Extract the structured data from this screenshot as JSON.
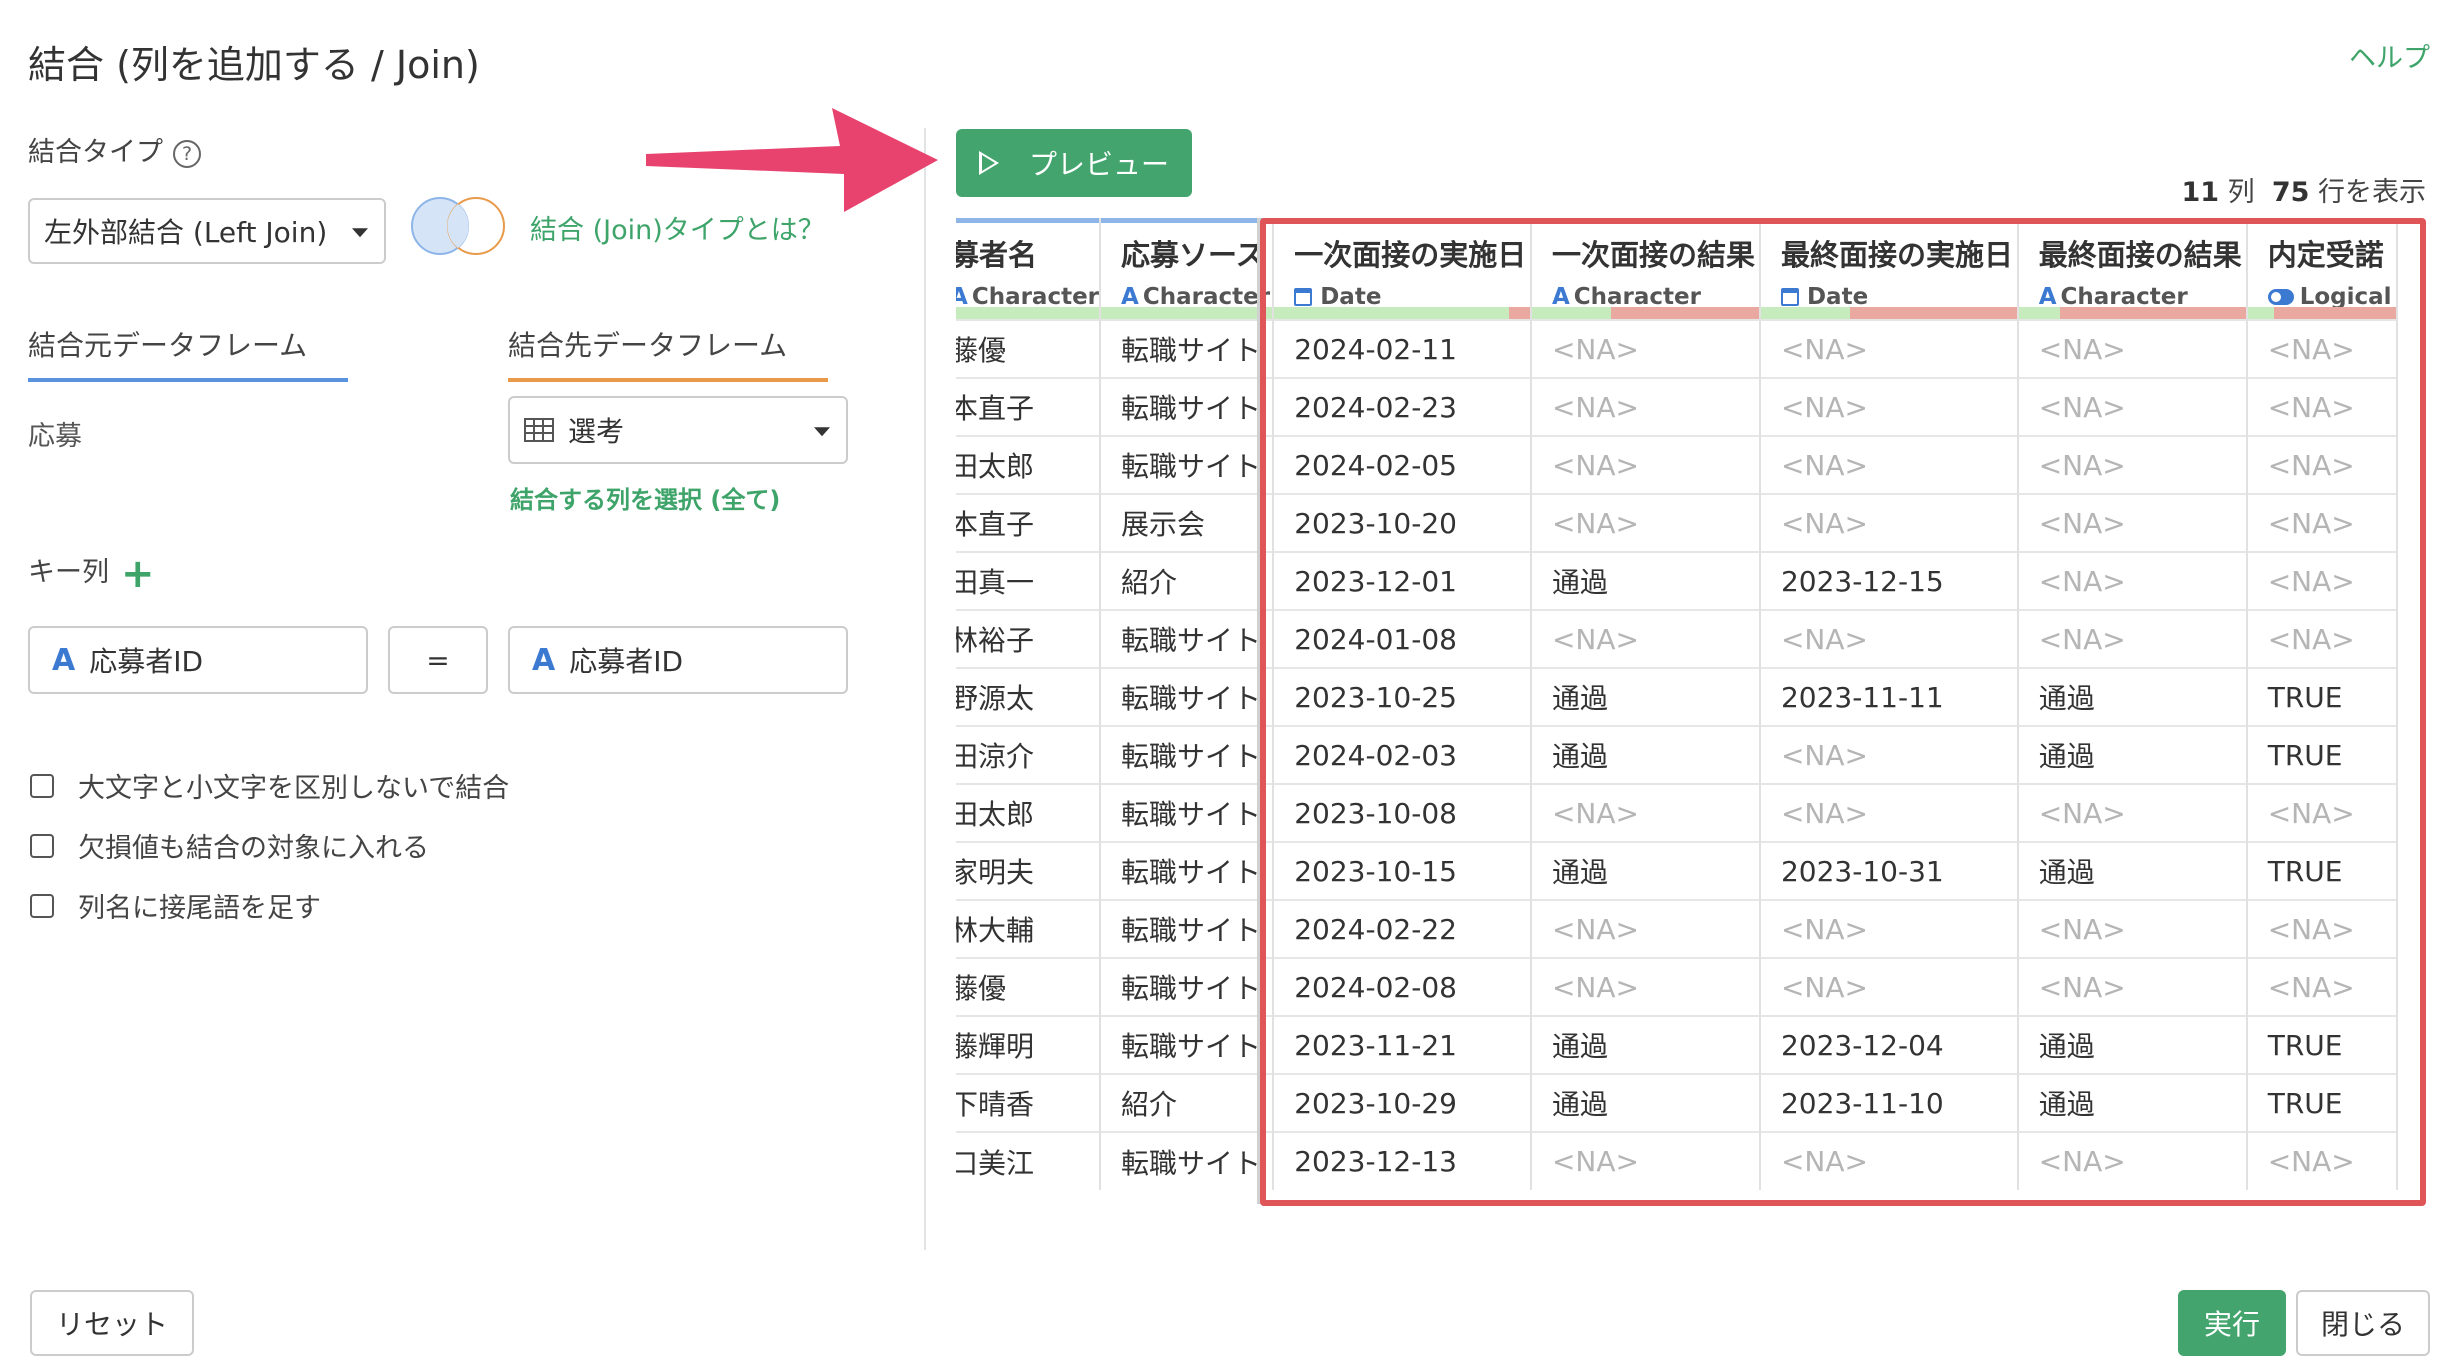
{
  "title": "結合 (列を追加する / Join)",
  "help": "ヘルプ",
  "join_type": {
    "label": "結合タイプ",
    "help_icon": "?",
    "value": "左外部結合 (Left Join)",
    "info_link": "結合 (Join)タイプとは？"
  },
  "tabs": {
    "source": "結合元データフレーム",
    "target": "結合先データフレーム"
  },
  "source_df": "応募",
  "target_df": {
    "value": "選考",
    "icon": "table-icon"
  },
  "select_columns_link": "結合する列を選択 (全て)",
  "key": {
    "label": "キー列",
    "add": "+",
    "left": "応募者ID",
    "op": "=",
    "right": "応募者ID",
    "type_icon": "A"
  },
  "options": [
    {
      "label": "大文字と小文字を区別しないで結合",
      "checked": false
    },
    {
      "label": "欠損値も結合の対象に入れる",
      "checked": false
    },
    {
      "label": "列名に接尾語を足す",
      "checked": false
    }
  ],
  "preview_button": "プレビュー",
  "counts": {
    "cols": "11",
    "cols_unit": "列",
    "rows": "75",
    "rows_unit": "行を表示"
  },
  "columns": [
    {
      "name": "募者名",
      "type": "Character",
      "type_icon": "A",
      "ok": 1.0
    },
    {
      "name": "応募ソース",
      "type": "Character",
      "type_icon": "A",
      "ok": 1.0
    },
    {
      "name": "一次面接の実施日",
      "type": "Date",
      "type_icon": "calendar",
      "ok": 0.92
    },
    {
      "name": "一次面接の結果",
      "type": "Character",
      "type_icon": "A",
      "ok": 0.35
    },
    {
      "name": "最終面接の実施日",
      "type": "Date",
      "type_icon": "calendar",
      "ok": 0.35
    },
    {
      "name": "最終面接の結果",
      "type": "Character",
      "type_icon": "A",
      "ok": 0.18
    },
    {
      "name": "内定受諾",
      "type": "Logical",
      "type_icon": "toggle",
      "ok": 0.18
    }
  ],
  "rows": [
    [
      "藤優",
      "転職サイト",
      "2024-02-11",
      "<NA>",
      "<NA>",
      "<NA>",
      "<NA>"
    ],
    [
      "本直子",
      "転職サイト",
      "2024-02-23",
      "<NA>",
      "<NA>",
      "<NA>",
      "<NA>"
    ],
    [
      "田太郎",
      "転職サイト",
      "2024-02-05",
      "<NA>",
      "<NA>",
      "<NA>",
      "<NA>"
    ],
    [
      "本直子",
      "展示会",
      "2023-10-20",
      "<NA>",
      "<NA>",
      "<NA>",
      "<NA>"
    ],
    [
      "田真一",
      "紹介",
      "2023-12-01",
      "通過",
      "2023-12-15",
      "<NA>",
      "<NA>"
    ],
    [
      "林裕子",
      "転職サイト",
      "2024-01-08",
      "<NA>",
      "<NA>",
      "<NA>",
      "<NA>"
    ],
    [
      "野源太",
      "転職サイト",
      "2023-10-25",
      "通過",
      "2023-11-11",
      "通過",
      "TRUE"
    ],
    [
      "田涼介",
      "転職サイト",
      "2024-02-03",
      "通過",
      "<NA>",
      "通過",
      "TRUE"
    ],
    [
      "田太郎",
      "転職サイト",
      "2023-10-08",
      "<NA>",
      "<NA>",
      "<NA>",
      "<NA>"
    ],
    [
      "家明夫",
      "転職サイト",
      "2023-10-15",
      "通過",
      "2023-10-31",
      "通過",
      "TRUE"
    ],
    [
      "林大輔",
      "転職サイト",
      "2024-02-22",
      "<NA>",
      "<NA>",
      "<NA>",
      "<NA>"
    ],
    [
      "藤優",
      "転職サイト",
      "2024-02-08",
      "<NA>",
      "<NA>",
      "<NA>",
      "<NA>"
    ],
    [
      "藤輝明",
      "転職サイト",
      "2023-11-21",
      "通過",
      "2023-12-04",
      "通過",
      "TRUE"
    ],
    [
      "下晴香",
      "紹介",
      "2023-10-29",
      "通過",
      "2023-11-10",
      "通過",
      "TRUE"
    ],
    [
      "口美江",
      "転職サイト",
      "2023-12-13",
      "<NA>",
      "<NA>",
      "<NA>",
      "<NA>"
    ]
  ],
  "footer": {
    "reset": "リセット",
    "run": "実行",
    "close": "閉じる"
  },
  "colors": {
    "accent_green": "#43a56d",
    "highlight_red": "#e05557",
    "arrow_pink": "#e8436e"
  }
}
